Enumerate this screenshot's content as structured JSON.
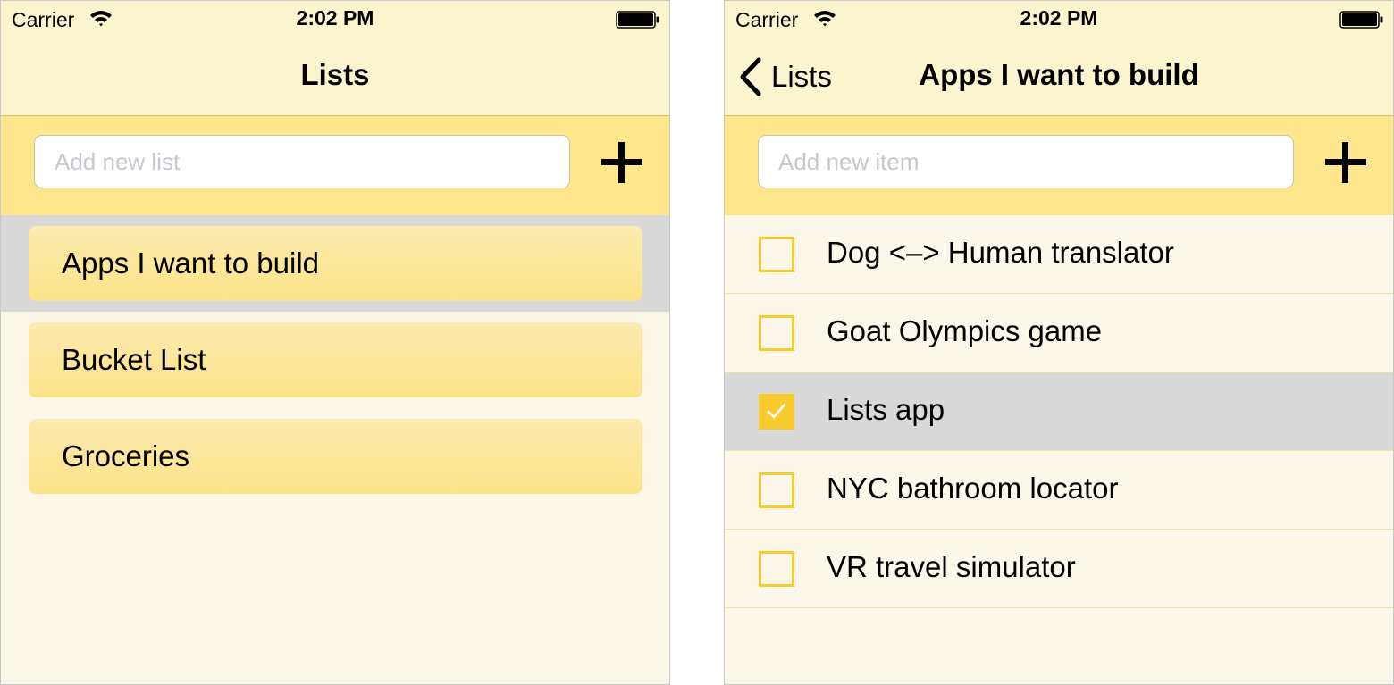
{
  "status_bar": {
    "carrier": "Carrier",
    "time": "2:02 PM"
  },
  "lists_screen": {
    "title": "Lists",
    "add_placeholder": "Add new list",
    "lists": [
      {
        "label": "Apps I want to build",
        "selected": true
      },
      {
        "label": "Bucket List",
        "selected": false
      },
      {
        "label": "Groceries",
        "selected": false
      }
    ]
  },
  "detail_screen": {
    "back_label": "Lists",
    "title": "Apps I want to build",
    "add_placeholder": "Add new item",
    "items": [
      {
        "label": "Dog <–> Human translator",
        "checked": false,
        "selected": false
      },
      {
        "label": "Goat Olympics game",
        "checked": false,
        "selected": false
      },
      {
        "label": "Lists app",
        "checked": true,
        "selected": true
      },
      {
        "label": "NYC bathroom locator",
        "checked": false,
        "selected": false
      },
      {
        "label": "VR travel simulator",
        "checked": false,
        "selected": false
      }
    ]
  },
  "colors": {
    "header": "#faf4cf",
    "add_bar": "#fde68c",
    "checkbox": "#f8cc2e",
    "selected_row": "#d9d9d9",
    "background": "#fbf8ea"
  }
}
